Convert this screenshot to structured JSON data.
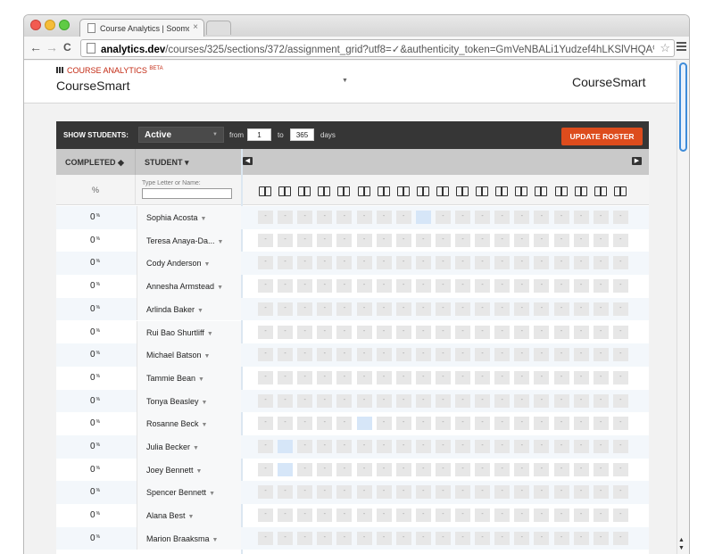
{
  "browser": {
    "tab_title": "Course Analytics | Soomo Pu",
    "tab_close": "×",
    "url_host": "analytics.dev",
    "url_path": "/courses/325/sections/372/assignment_grid?utf8=✓&authenticity_token=GmVeNBALi1Yudzef4hLKSlVHQA%2BdxhEDyoch2Q...",
    "back": "←",
    "forward": "→",
    "reload": "C",
    "star": "☆"
  },
  "header": {
    "brand_small": "COURSE ANALYTICS",
    "beta": "BETA",
    "brand_big": "CourseSmart",
    "caret": "▼",
    "right_title": "CourseSmart"
  },
  "filterbar": {
    "show_students_label": "SHOW STUDENTS:",
    "status_value": "Active",
    "caret": "▼",
    "from_label": "from",
    "from_value": "1",
    "to_label": "to",
    "to_value": "365",
    "days_label": "days",
    "update_button": "UPDATE ROSTER"
  },
  "columns": {
    "completed": "COMPLETED ◆",
    "student": "STUDENT ▾",
    "left_arrow": "◀",
    "right_arrow": "▶",
    "pct_label": "%",
    "filter_label": "Type Letter or Name:",
    "book_count": 19
  },
  "cell_text": "-",
  "students": [
    {
      "pct": "0",
      "name": "Sophia Acosta",
      "hl": [
        8
      ]
    },
    {
      "pct": "0",
      "name": "Teresa Anaya-Da...",
      "hl": []
    },
    {
      "pct": "0",
      "name": "Cody Anderson",
      "hl": []
    },
    {
      "pct": "0",
      "name": "Annesha Armstead",
      "hl": []
    },
    {
      "pct": "0",
      "name": "Arlinda Baker",
      "hl": []
    },
    {
      "pct": "0",
      "name": "Rui Bao Shurtliff",
      "hl": []
    },
    {
      "pct": "0",
      "name": "Michael Batson",
      "hl": []
    },
    {
      "pct": "0",
      "name": "Tammie Bean",
      "hl": []
    },
    {
      "pct": "0",
      "name": "Tonya Beasley",
      "hl": []
    },
    {
      "pct": "0",
      "name": "Rosanne Beck",
      "hl": [
        5
      ]
    },
    {
      "pct": "0",
      "name": "Julia Becker",
      "hl": [
        1
      ]
    },
    {
      "pct": "0",
      "name": "Joey Bennett",
      "hl": [
        1
      ]
    },
    {
      "pct": "0",
      "name": "Spencer Bennett",
      "hl": []
    },
    {
      "pct": "0",
      "name": "Alana Best",
      "hl": []
    },
    {
      "pct": "0",
      "name": "Marion Braaksma",
      "hl": []
    }
  ],
  "pct_symbol": "%",
  "row_caret": "▼"
}
